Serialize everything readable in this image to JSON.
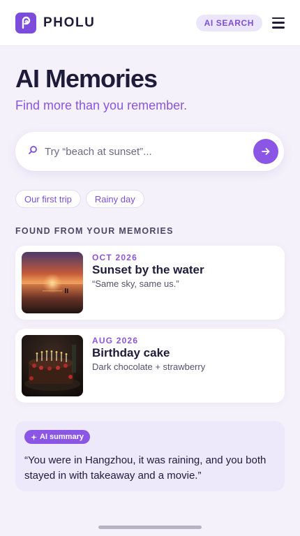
{
  "header": {
    "brand": "PHOLU",
    "ai_search_label": "AI SEARCH"
  },
  "hero": {
    "title": "AI Memories",
    "subtitle": "Find more than you remember."
  },
  "search": {
    "placeholder": "Try “beach at sunset”..."
  },
  "chips": [
    "Our first trip",
    "Rainy day"
  ],
  "section_label": "FOUND FROM YOUR MEMORIES",
  "memories": [
    {
      "date": "OCT 2026",
      "title": "Sunset by the water",
      "description": "“Same sky, same us.”"
    },
    {
      "date": "AUG 2026",
      "title": "Birthday cake",
      "description": "Dark chocolate + strawberry"
    }
  ],
  "summary": {
    "badge": "AI summary",
    "text": "“You were in Hangzhou, it was raining, and you both stayed in with takeaway and a movie.”"
  },
  "colors": {
    "accent": "#8b55e6",
    "text": "#1f1b3a",
    "background": "#f4f1fb"
  }
}
